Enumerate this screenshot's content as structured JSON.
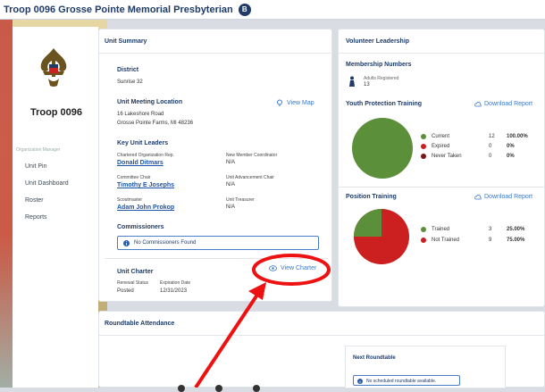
{
  "topbar": {
    "title": "Troop 0096 Grosse Pointe Memorial Presbyterian",
    "badge": "B"
  },
  "sidebar": {
    "troop_name": "Troop 0096",
    "section_label": "Organization Manager",
    "items": [
      {
        "label": "Unit Pin"
      },
      {
        "label": "Unit Dashboard"
      },
      {
        "label": "Roster"
      },
      {
        "label": "Reports"
      }
    ]
  },
  "summary": {
    "title": "Unit Summary",
    "district_label": "District",
    "district_value": "Sunrise 32",
    "meeting_label": "Unit Meeting Location",
    "view_map": "View Map",
    "address_line1": "16 Lakeshore Road",
    "address_line2": "Grosse Pointe Farms, MI 48236",
    "key_leaders_label": "Key Unit Leaders",
    "leaders": [
      {
        "role": "Chartered Organization Rep.",
        "name": "Donald Ditmars"
      },
      {
        "role": "New Member Coordinator",
        "name": "N/A"
      },
      {
        "role": "Committee Chair",
        "name": "Timothy E Josephs"
      },
      {
        "role": "Unit Advancement Chair",
        "name": "N/A"
      },
      {
        "role": "Scoutmaster",
        "name": "Adam John Prokop"
      },
      {
        "role": "Unit Treasurer",
        "name": "N/A"
      }
    ],
    "commissioners_label": "Commissioners",
    "no_commissioners": "No Commissioners Found",
    "charter_label": "Unit Charter",
    "view_charter": "View Charter",
    "renewal_status_label": "Renewal Status",
    "renewal_status_value": "Posted",
    "expiration_label": "Expiration Date",
    "expiration_value": "12/31/2023"
  },
  "volunteer": {
    "title": "Volunteer Leadership",
    "membership_label": "Membership Numbers",
    "adults_label": "Adults Registered",
    "adults_value": "13",
    "ypt_title": "Youth Protection Training",
    "download_report": "Download Report",
    "ypt_legend": [
      {
        "label": "Current",
        "count": "12",
        "pct": "100.00%",
        "color": "#5b8f3a"
      },
      {
        "label": "Expired",
        "count": "0",
        "pct": "0%",
        "color": "#cc1f1f"
      },
      {
        "label": "Never Taken",
        "count": "0",
        "pct": "0%",
        "color": "#7a1616"
      }
    ],
    "position_title": "Position Training",
    "position_legend": [
      {
        "label": "Trained",
        "count": "3",
        "pct": "25.00%",
        "color": "#5b8f3a"
      },
      {
        "label": "Not Trained",
        "count": "9",
        "pct": "75.00%",
        "color": "#cc1f1f"
      }
    ]
  },
  "roundtable": {
    "title": "Roundtable Attendance",
    "next_label": "Next Roundtable",
    "no_scheduled": "No scheduled roundtable available."
  },
  "colors": {
    "accent": "#1f3b66",
    "link": "#1a55a8",
    "annotation": "#ee1111"
  }
}
